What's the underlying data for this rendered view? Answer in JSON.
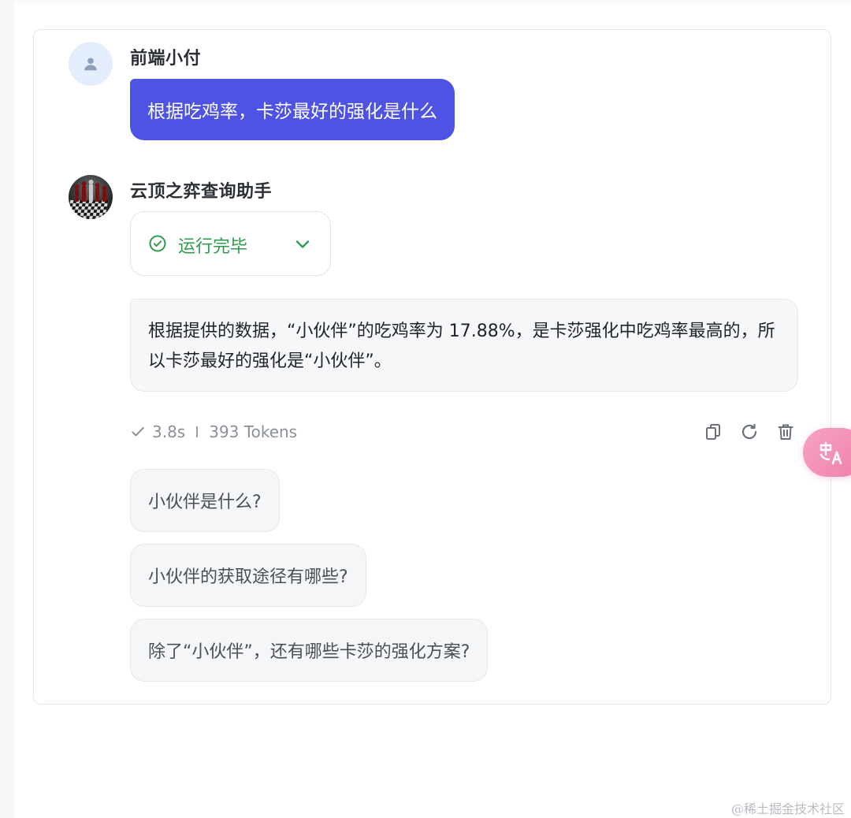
{
  "user_message": {
    "name": "前端小付",
    "text": "根据吃鸡率，卡莎最好的强化是什么"
  },
  "bot_message": {
    "name": "云顶之弈查询助手",
    "status": "运行完毕",
    "answer": "根据提供的数据，“小伙伴”的吃鸡率为 17.88%，是卡莎强化中吃鸡率最高的，所以卡莎最好的强化是“小伙伴”。",
    "meta": {
      "duration": "3.8s",
      "tokens": "393 Tokens"
    }
  },
  "suggestions": [
    "小伙伴是什么?",
    "小伙伴的获取途径有哪些?",
    "除了“小伙伴”，还有哪些卡莎的强化方案?"
  ],
  "icons": {
    "user_avatar": "person-icon",
    "status": "check-circle-icon",
    "expand": "chevron-down-icon",
    "meta": "check-icon",
    "actions": [
      "copy-icon",
      "refresh-icon",
      "delete-icon"
    ],
    "fab": "translate-icon"
  },
  "colors": {
    "accent": "#4e53e4",
    "success": "#2e9b4f",
    "fab": "#ef7fab"
  },
  "watermark": "@稀土掘金技术社区"
}
